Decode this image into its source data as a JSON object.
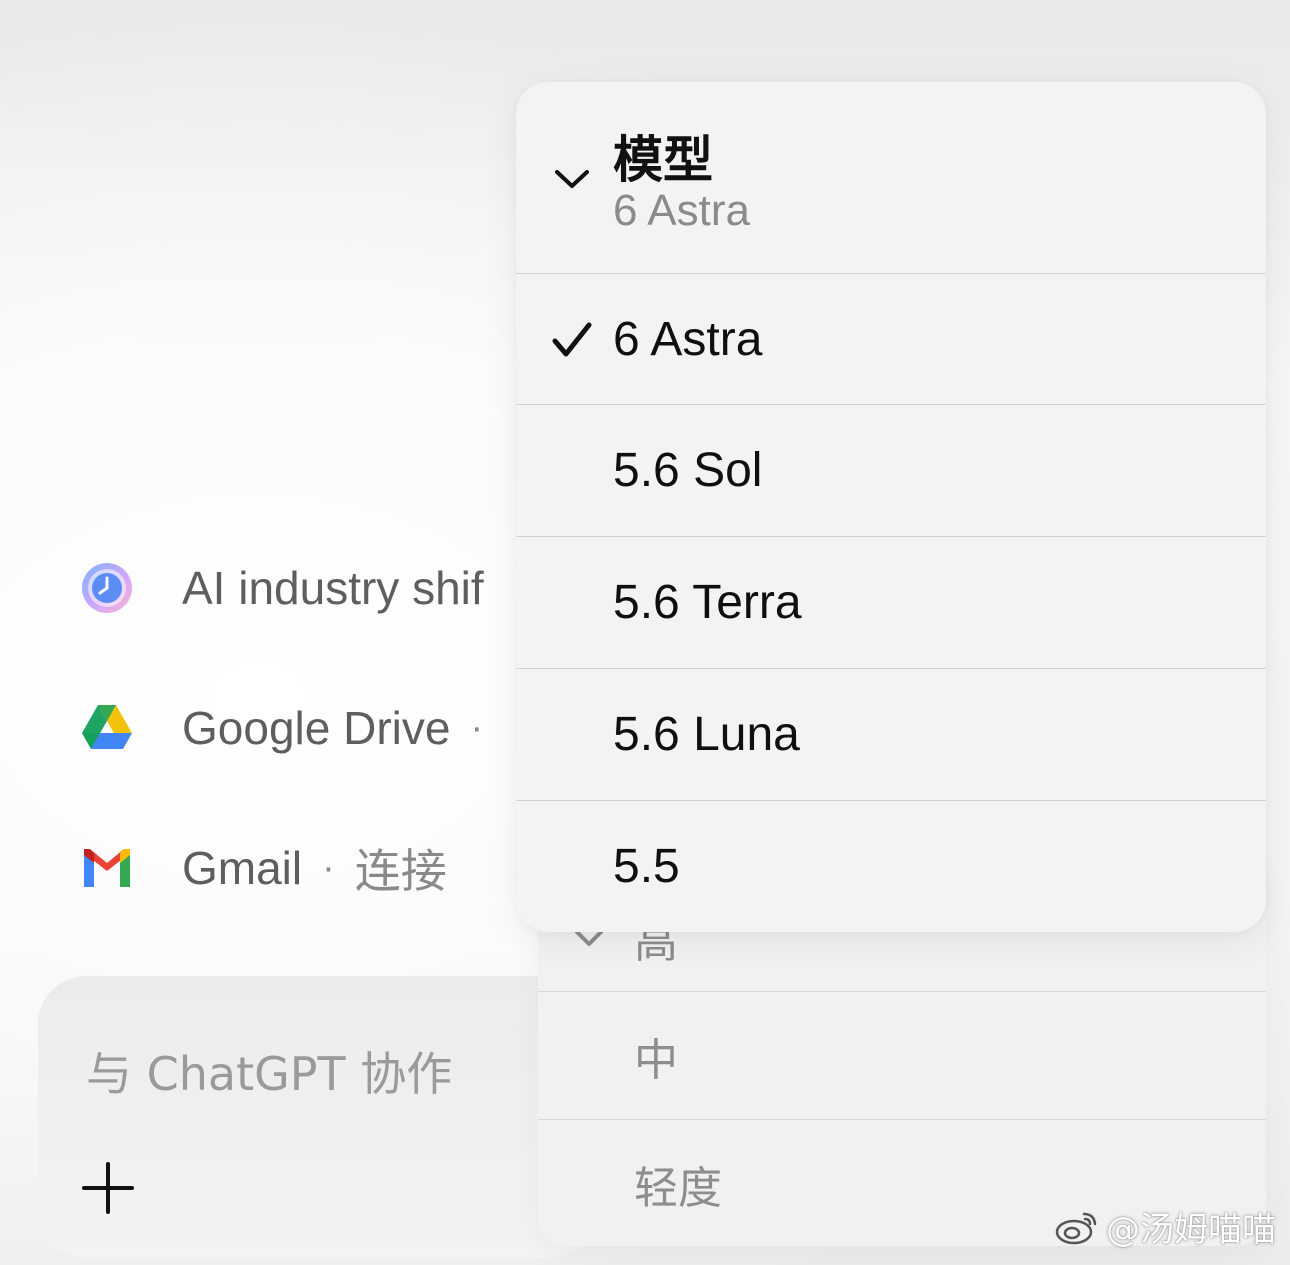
{
  "conversations": [
    {
      "title": "AI industry shif",
      "icon": "scheduled-task-icon"
    },
    {
      "title": "Google Drive",
      "separator": "·",
      "status": "",
      "icon": "google-drive-icon"
    },
    {
      "title": "Gmail",
      "separator": "·",
      "status": "连接",
      "icon": "gmail-icon"
    }
  ],
  "composer": {
    "placeholder": "与 ChatGPT 协作",
    "plus_icon": "plus-icon"
  },
  "effort_menu": {
    "hidden_label": "高",
    "items": [
      "中",
      "轻度"
    ]
  },
  "model_menu": {
    "title": "模型",
    "current": "6 Astra",
    "items": [
      {
        "label": "6 Astra",
        "selected": true
      },
      {
        "label": "5.6 Sol",
        "selected": false
      },
      {
        "label": "5.6 Terra",
        "selected": false
      },
      {
        "label": "5.6 Luna",
        "selected": false
      },
      {
        "label": "5.5",
        "selected": false
      }
    ]
  },
  "watermark": "@汤姆喵喵",
  "colors": {
    "menu_bg": "#f3f3f3",
    "text_primary": "#0f0f0f",
    "text_secondary": "#8b8b8b"
  }
}
